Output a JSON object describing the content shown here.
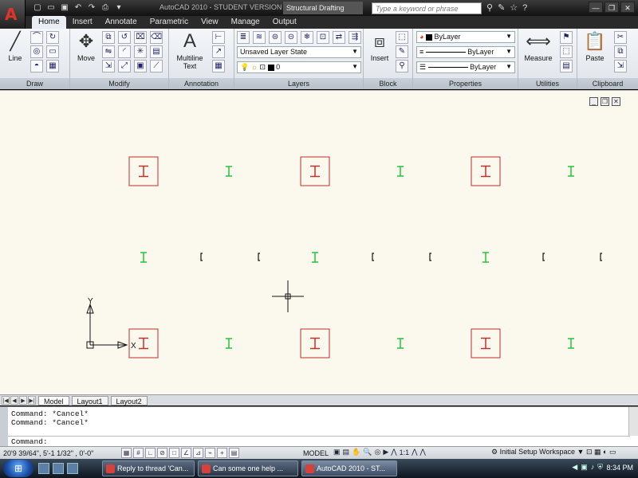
{
  "titlebar": {
    "app_title": "AutoCAD 2010 - STUDENT VERSION",
    "workspace": "Structural Drafting",
    "search_placeholder": "Type a keyword or phrase"
  },
  "ribbon_tabs": [
    "Home",
    "Insert",
    "Annotate",
    "Parametric",
    "View",
    "Manage",
    "Output"
  ],
  "panels": {
    "draw": {
      "title": "Draw",
      "line_label": "Line"
    },
    "modify": {
      "title": "Modify",
      "move_label": "Move"
    },
    "annotation": {
      "title": "Annotation",
      "multiline_label": "Multiline",
      "text_label": "Text"
    },
    "layers": {
      "title": "Layers",
      "layer_state": "Unsaved Layer State",
      "current_layer": "0"
    },
    "block": {
      "title": "Block",
      "insert_label": "Insert"
    },
    "properties": {
      "title": "Properties",
      "color": "ByLayer",
      "linetype": "ByLayer",
      "lineweight": "ByLayer"
    },
    "utilities": {
      "title": "Utilities",
      "measure_label": "Measure"
    },
    "clipboard": {
      "title": "Clipboard",
      "paste_label": "Paste"
    }
  },
  "drawing": {
    "ucs_x": "X",
    "ucs_y": "Y"
  },
  "layout_tabs": [
    "Model",
    "Layout1",
    "Layout2"
  ],
  "command_line": {
    "history": [
      "Command: *Cancel*",
      "Command: *Cancel*"
    ],
    "prompt": "Command:"
  },
  "statusbar": {
    "coordinates": "20'9 39/64\", 5'-1 1/32\" , 0'-0\"",
    "model_label": "MODEL",
    "annotation_scale": "1:1",
    "workspace_switch": "Initial Setup Workspace"
  },
  "taskbar": {
    "tasks": [
      "Reply to thread 'Can...",
      "Can some one help ...",
      "AutoCAD 2010 - ST..."
    ],
    "clock": "8:34 PM"
  },
  "colors": {
    "canvas_bg": "#fbf9ee",
    "framed_column": "#c0302a",
    "green_column": "#22c43a",
    "black_marker": "#111111"
  }
}
